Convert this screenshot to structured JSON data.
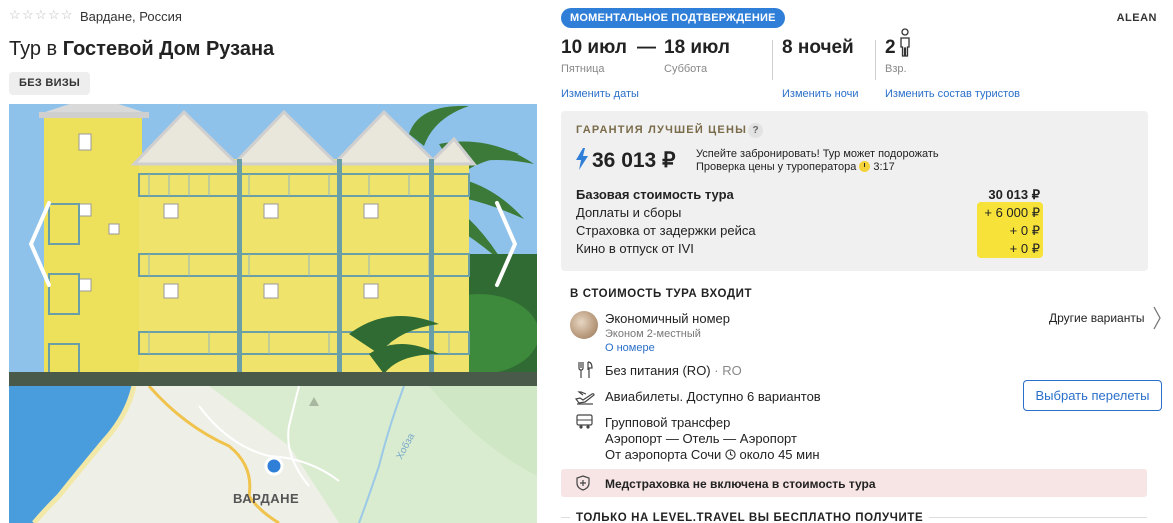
{
  "hotel": {
    "stars_icon": "star-outline-icon",
    "location": "Вардане, Россия",
    "title_prefix": "Тур в ",
    "title_name": "Гостевой Дом Рузана",
    "visa_badge": "БЕЗ ВИЗЫ"
  },
  "map": {
    "place_label": "ВАРДАНЕ",
    "river_label": "Хобза"
  },
  "booking": {
    "confirm_badge": "МОМЕНТАЛЬНОЕ ПОДТВЕРЖДЕНИЕ",
    "operator": "ALEAN",
    "date_from": "10 июл",
    "date_from_day": "Пятница",
    "date_to": "18 июл",
    "date_to_day": "Суббота",
    "date_dash": "—",
    "nights": "8 ночей",
    "guests": "2",
    "guests_label": "Взр.",
    "change_dates": "Изменить даты",
    "change_nights": "Изменить ночи",
    "change_tourists": "Изменить состав туристов"
  },
  "price": {
    "guarantee": "ГАРАНТИЯ ЛУЧШЕЙ ЦЕНЫ",
    "help": "?",
    "total": "36 013 ₽",
    "hurry": "Успейте забронировать! Тур может подорожать",
    "check_label": "Проверка цены у туроператора",
    "check_timer": "3:17",
    "rows": [
      {
        "label": "Базовая стоимость тура",
        "value": "30 013 ₽",
        "bold": true
      },
      {
        "label": "Доплаты и сборы",
        "value": "+ 6 000 ₽"
      },
      {
        "label": "Страховка от задержки рейса",
        "value": "+ 0 ₽"
      },
      {
        "label": "Кино в отпуск от IVI",
        "value": "+ 0 ₽"
      }
    ]
  },
  "included": {
    "heading": "В СТОИМОСТЬ ТУРА ВХОДИТ",
    "room_name": "Экономичный номер",
    "room_type": "Эконом 2-местный",
    "room_link": "О номере",
    "other_variants": "Другие варианты",
    "meal": "Без питания (RO)",
    "meal_sep": "·",
    "meal_code": "RO",
    "flights": "Авиабилеты. Доступно 6 вариантов",
    "flights_button": "Выбрать перелеты",
    "transfer_title": "Групповой трансфер",
    "transfer_route": "Аэропорт — Отель — Аэропорт",
    "transfer_from": "От аэропорта Сочи",
    "transfer_time": "около 45 мин"
  },
  "insurance": {
    "text": "Медстраховка не включена в стоимость тура"
  },
  "free": {
    "heading": "ТОЛЬКО НА LEVEL.TRAVEL ВЫ БЕСПЛАТНО ПОЛУЧИТЕ"
  },
  "colors": {
    "accent_blue": "#2f7fd8",
    "link_blue": "#2a6fc9",
    "highlight_yellow": "#f7e23a",
    "insurance_pink": "#f7e4e4",
    "guarantee_brown": "#7a6b4a"
  }
}
